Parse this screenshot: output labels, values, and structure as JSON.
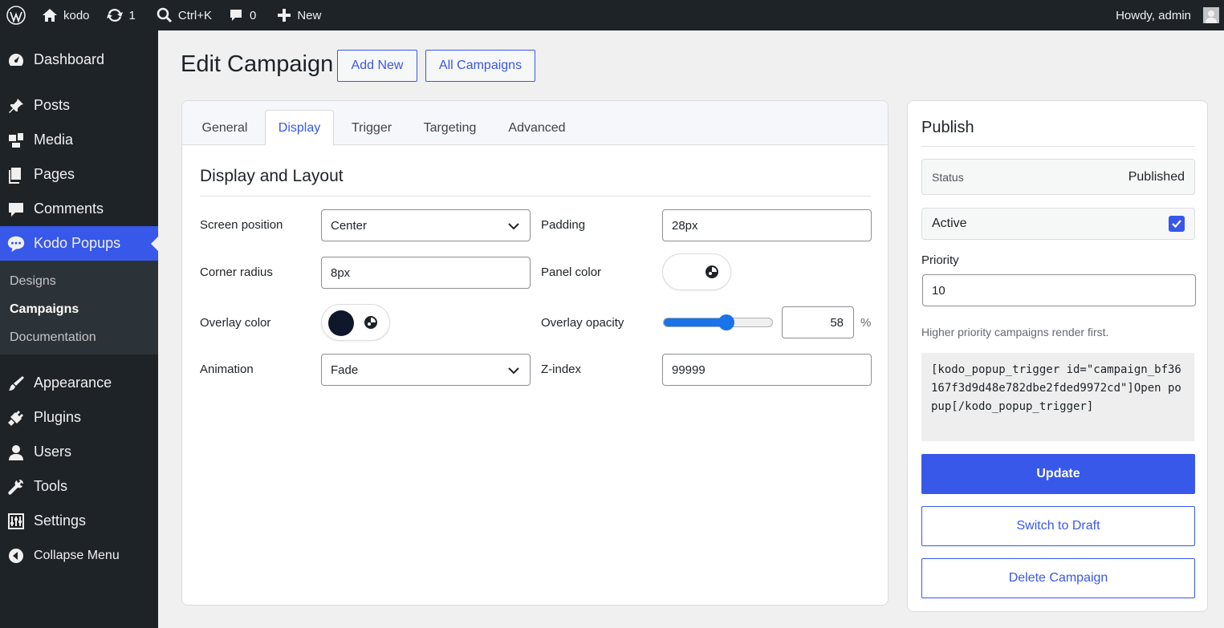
{
  "adminbar": {
    "site_name": "kodo",
    "updates_count": "1",
    "search_shortcut": "Ctrl+K",
    "comments_count": "0",
    "new_label": "New",
    "greeting": "Howdy, admin"
  },
  "sidebar": {
    "items_top": [
      {
        "label": "Dashboard",
        "icon": "dashboard-icon"
      },
      {
        "label": "Posts",
        "icon": "pin-icon"
      },
      {
        "label": "Media",
        "icon": "media-icon"
      },
      {
        "label": "Pages",
        "icon": "pages-icon"
      },
      {
        "label": "Comments",
        "icon": "comment-icon"
      },
      {
        "label": "Kodo Popups",
        "icon": "chat-bubbles-icon"
      }
    ],
    "submenu": [
      "Designs",
      "Campaigns",
      "Documentation"
    ],
    "items_bottom": [
      {
        "label": "Appearance",
        "icon": "brush-icon"
      },
      {
        "label": "Plugins",
        "icon": "plug-icon"
      },
      {
        "label": "Users",
        "icon": "user-icon"
      },
      {
        "label": "Tools",
        "icon": "wrench-icon"
      },
      {
        "label": "Settings",
        "icon": "sliders-icon"
      },
      {
        "label": "Collapse Menu",
        "icon": "collapse-icon"
      }
    ]
  },
  "header": {
    "title": "Edit Campaign",
    "add_new": "Add New",
    "all_campaigns": "All Campaigns"
  },
  "tabs": [
    "General",
    "Display",
    "Trigger",
    "Targeting",
    "Advanced"
  ],
  "active_tab": "Display",
  "display": {
    "section_title": "Display and Layout",
    "screen_position": {
      "label": "Screen position",
      "value": "Center"
    },
    "padding": {
      "label": "Padding",
      "value": "28px"
    },
    "corner_radius": {
      "label": "Corner radius",
      "value": "8px"
    },
    "panel_color": {
      "label": "Panel color",
      "value": "#ffffff"
    },
    "overlay_color": {
      "label": "Overlay color",
      "value": "#0f172a"
    },
    "overlay_opacity": {
      "label": "Overlay opacity",
      "value": "58",
      "unit": "%",
      "fraction": 0.58
    },
    "animation": {
      "label": "Animation",
      "value": "Fade"
    },
    "z_index": {
      "label": "Z-index",
      "value": "99999"
    }
  },
  "publish": {
    "title": "Publish",
    "status_label": "Status",
    "status_value": "Published",
    "active_label": "Active",
    "active_checked": true,
    "priority_label": "Priority",
    "priority_value": "10",
    "priority_help": "Higher priority campaigns render first.",
    "shortcode": "[kodo_popup_trigger id=\"campaign_bf36167f3d9d48e782dbe2fded9972cd\"]Open popup[/kodo_popup_trigger]",
    "update": "Update",
    "switch_to_draft": "Switch to Draft",
    "delete": "Delete Campaign"
  },
  "colors": {
    "accent": "#3858e9",
    "sidebar_bg": "#1d2327",
    "slider": "#1a73e8"
  }
}
